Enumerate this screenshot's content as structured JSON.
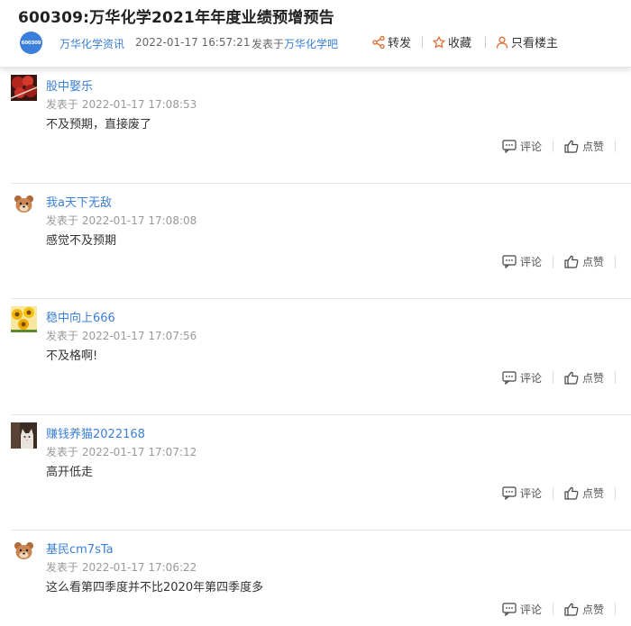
{
  "post": {
    "title": "600309:万华化学2021年年度业绩预增预告",
    "logo_text": "600309",
    "author": "万华化学资讯",
    "time": "2022-01-17 16:57:21",
    "posted_in_prefix": "发表于",
    "forum": "万华化学吧",
    "share_label": "转发",
    "favorite_label": "收藏",
    "owner_only_label": "只看楼主"
  },
  "labels": {
    "reply": "评论",
    "like": "点赞"
  },
  "comments": [
    {
      "user": "股中娶乐",
      "time": "发表于 2022-01-17 17:08:53",
      "text": "不及预期，直接废了",
      "avatar": "red-leaf-avatar"
    },
    {
      "user": "我a天下无敌",
      "time": "发表于 2022-01-17 17:08:08",
      "text": "感觉不及预期",
      "avatar": "default-bear-avatar"
    },
    {
      "user": "稳中向上666",
      "time": "发表于 2022-01-17 17:07:56",
      "text": "不及格啊!",
      "avatar": "sunflower-avatar"
    },
    {
      "user": "赚钱养猫2022168",
      "time": "发表于 2022-01-17 17:07:12",
      "text": "高开低走",
      "avatar": "cat-photo-avatar"
    },
    {
      "user": "基民cm7sTa",
      "time": "发表于 2022-01-17 17:06:22",
      "text": "这么看第四季度并不比2020年第四季度多",
      "avatar": "default-bear-avatar"
    }
  ]
}
